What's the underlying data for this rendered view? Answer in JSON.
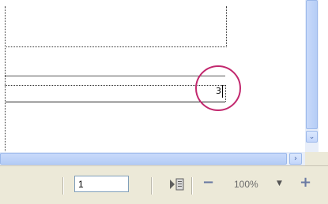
{
  "document": {
    "row_number": "3"
  },
  "scrollbars": {
    "down_arrow": "⌄",
    "right_arrow": "›"
  },
  "statusbar": {
    "page_number": "1",
    "zoom_out": "−",
    "zoom_level": "100%",
    "zoom_dropdown": "▼",
    "zoom_in": "+"
  },
  "colors": {
    "highlight": "#c2286e",
    "scrollbar": "#c9dafa",
    "statusbar_bg": "#ece9d8"
  }
}
